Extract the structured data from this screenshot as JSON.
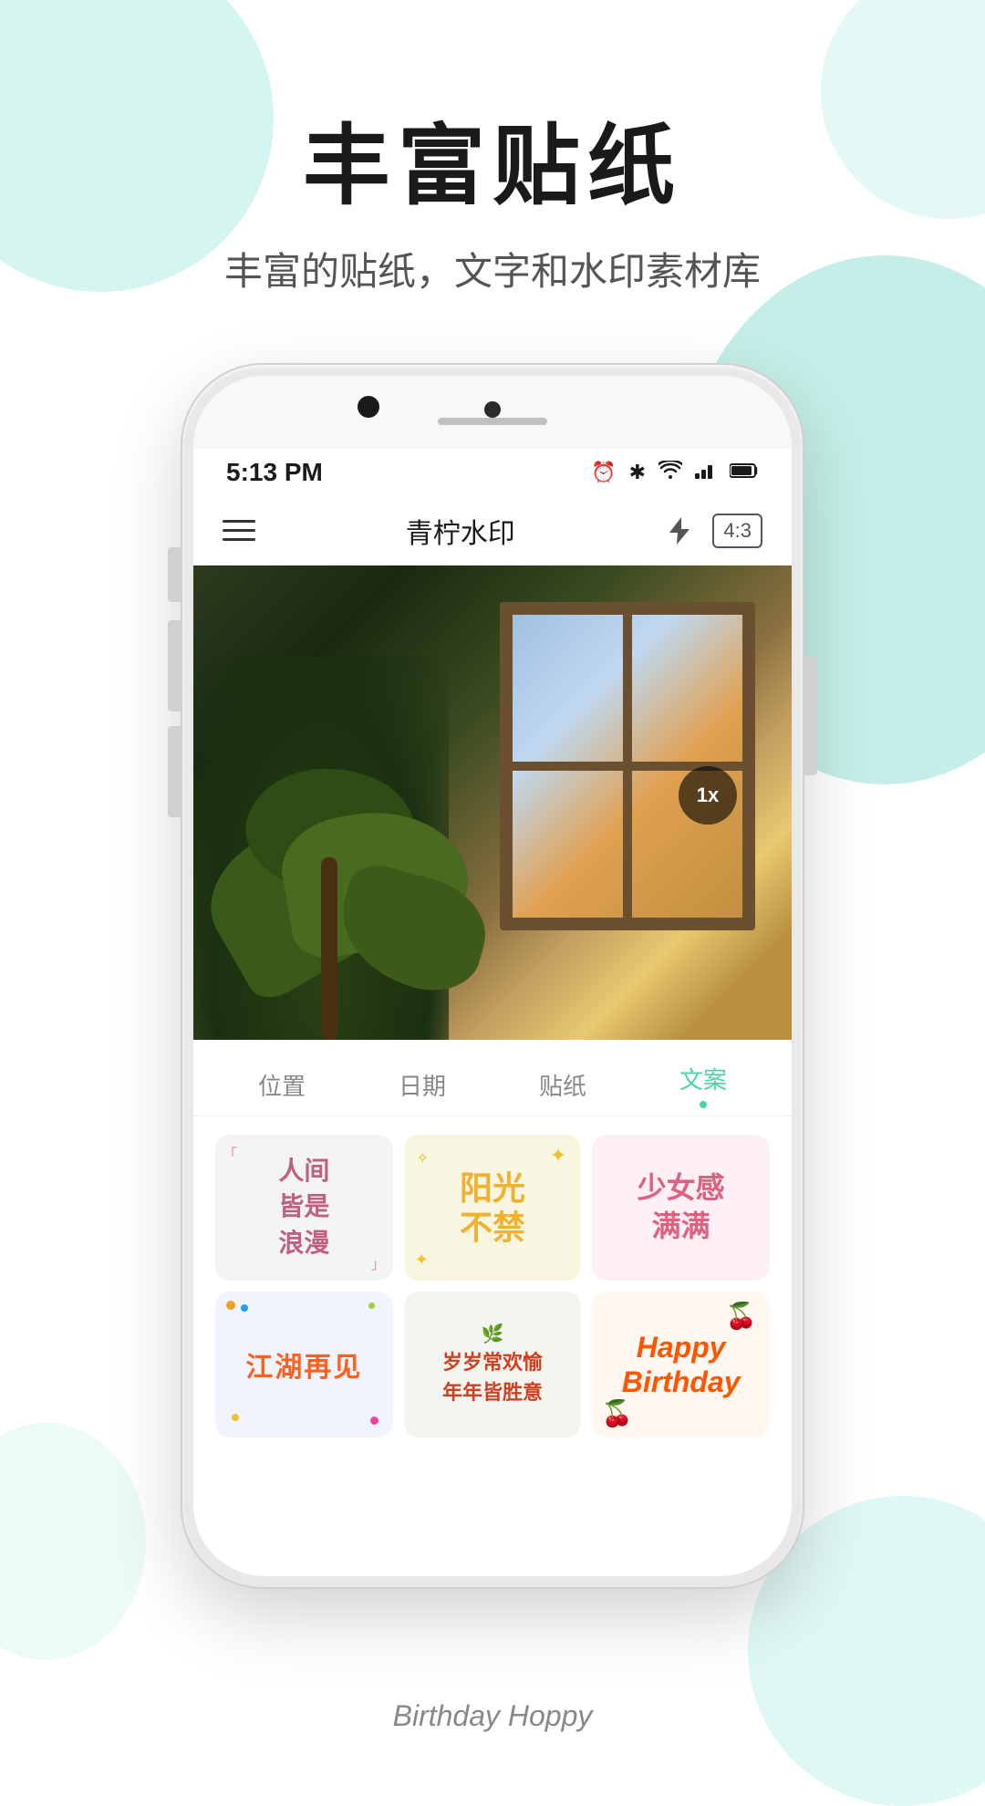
{
  "page": {
    "background": "#ffffff"
  },
  "decorations": {
    "blob_colors": [
      "#b2ede4",
      "#7dd9ca",
      "#c8f0ea"
    ]
  },
  "text_section": {
    "main_title": "丰富贴纸",
    "sub_title": "丰富的贴纸，文字和水印素材库"
  },
  "phone": {
    "status_bar": {
      "time": "5:13 PM",
      "icons": [
        "⏰",
        "✳",
        "wifi",
        "signal",
        "battery"
      ]
    },
    "app_header": {
      "title": "青柠水印",
      "ratio_badge": "4:3"
    },
    "photo": {
      "zoom": "1x"
    },
    "tabs": [
      {
        "label": "位置",
        "active": false
      },
      {
        "label": "日期",
        "active": false
      },
      {
        "label": "贴纸",
        "active": false
      },
      {
        "label": "文案",
        "active": true
      }
    ],
    "stickers": [
      {
        "id": 1,
        "text": "「人间\n皆是\n浪漫」",
        "style": "romantic"
      },
      {
        "id": 2,
        "text": "阳光\n不禁",
        "style": "sunshine"
      },
      {
        "id": 3,
        "text": "少女感\n满满",
        "style": "girl"
      },
      {
        "id": 4,
        "text": "江湖再见",
        "style": "jianghu"
      },
      {
        "id": 5,
        "text": "岁岁常欢愉\n年年皆胜意",
        "style": "happy_year"
      },
      {
        "id": 6,
        "text": "Happy\nBirthday",
        "style": "birthday"
      }
    ]
  },
  "bottom_label": {
    "text": "Birthday Hoppy"
  }
}
